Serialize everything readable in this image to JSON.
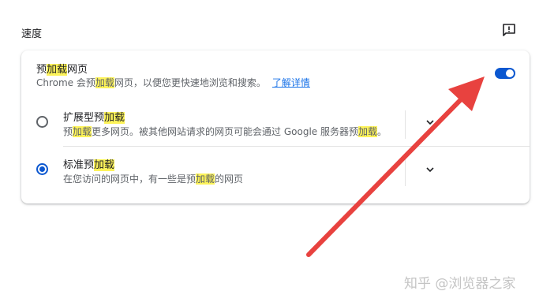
{
  "section": {
    "title": "速度",
    "feedback_icon": "feedback-icon"
  },
  "preload": {
    "title_pre": "预",
    "title_hl": "加载",
    "title_post": "网页",
    "desc_pre": "Chrome 会预",
    "desc_hl": "加载",
    "desc_post": "网页，以便您更快速地浏览和搜索。",
    "learn_more": "了解详情",
    "toggle_on": true
  },
  "options": [
    {
      "title_pre": "扩展型预",
      "title_hl": "加载",
      "desc_pre": "预",
      "desc_hl": "加载",
      "desc_mid": "更多网页。被其他网站请求的网页可能会通过 Google 服务器预",
      "desc_hl2": "加载",
      "desc_post": "。",
      "checked": false,
      "expand_icon": "chevron-down-icon"
    },
    {
      "title_pre": "标准预",
      "title_hl": "加载",
      "desc_pre": "在您访问的网页中，有一些是预",
      "desc_hl": "加载",
      "desc_post": "的网页",
      "checked": true,
      "expand_icon": "chevron-down-icon"
    }
  ],
  "colors": {
    "accent": "#0b57d0",
    "highlight": "#fdf35a",
    "annotation_arrow": "#e8423f"
  },
  "watermark": "知乎 @浏览器之家"
}
